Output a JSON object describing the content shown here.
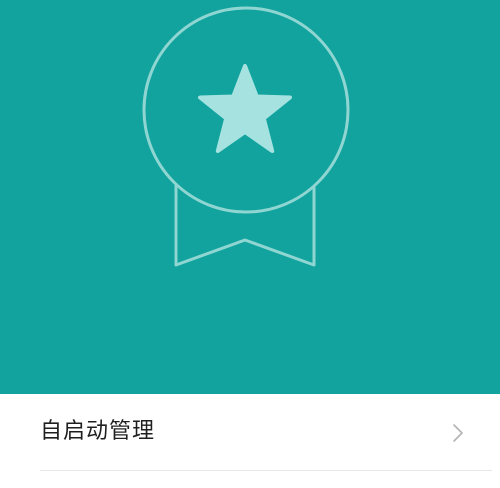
{
  "hero": {
    "background_color": "#12A39E",
    "outline_color": "#8FD6D2",
    "star_color": "#A6E3E0",
    "icon": "award-ribbon-star-icon"
  },
  "menu": {
    "items": [
      {
        "label": "自启动管理",
        "trailing_icon": "chevron-right-icon"
      }
    ]
  }
}
